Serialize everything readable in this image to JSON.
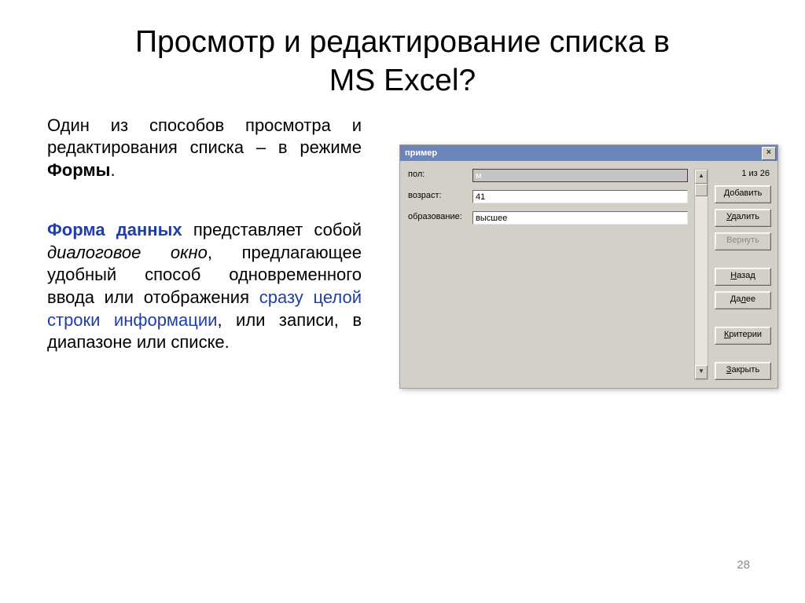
{
  "title_line1": "Просмотр и редактирование списка в",
  "title_line2": "MS Excel?",
  "para1_a": "Один из способов просмотра и редактирования списка – в режиме ",
  "para1_b": "Формы",
  "para1_c": ".",
  "para2": {
    "a": "Форма данных",
    "b": " представляет собой ",
    "c": "диалоговое окно",
    "d": ", предлагающее удобный способ одновременного ввода или отображения ",
    "e": "сразу целой строки информации",
    "f": ", или записи, в диапазоне или списке."
  },
  "page_number": "28",
  "dialog": {
    "title": "пример",
    "counter": "1 из 26",
    "fields": [
      {
        "label": "пол:",
        "value": "м",
        "selected": true
      },
      {
        "label": "возраст:",
        "value": "41",
        "selected": false
      },
      {
        "label": "образование:",
        "value": "высшее",
        "selected": false
      }
    ],
    "buttons": {
      "add": "Добавить",
      "delete": "Удалить",
      "restore": "Вернуть",
      "prev": "Назад",
      "next": "Далее",
      "criteria": "Критерии",
      "close": "Закрыть"
    },
    "close_x": "×"
  }
}
